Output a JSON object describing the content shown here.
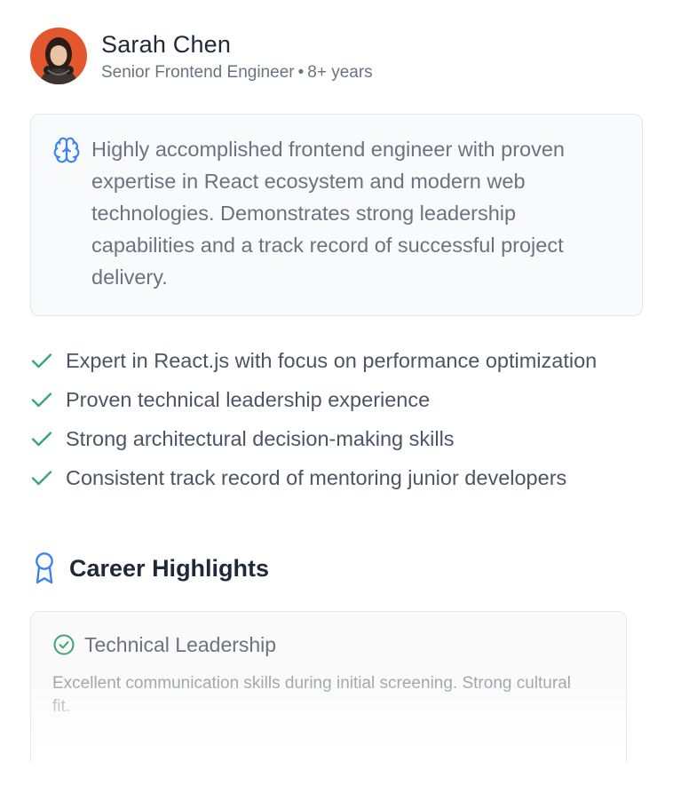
{
  "profile": {
    "name": "Sarah Chen",
    "role": "Senior Frontend Engineer",
    "separator": "•",
    "experience": "8+ years",
    "avatar_icon": "avatar-photo"
  },
  "summary": {
    "icon": "brain-icon",
    "text": "Highly accomplished frontend engineer with proven expertise in React ecosystem and modern web technologies. Demonstrates strong leadership capabilities and a track record of successful project delivery."
  },
  "strengths": [
    "Expert in React.js with focus on performance optimization",
    "Proven technical leadership experience",
    "Strong architectural decision-making skills",
    "Consistent track record of mentoring junior developers"
  ],
  "highlights": {
    "title": "Career Highlights",
    "icon": "award-icon",
    "items": [
      {
        "title": "Technical Leadership",
        "description": "Excellent communication skills during initial screening. Strong cultural fit."
      }
    ]
  },
  "colors": {
    "check_green": "#3aa873",
    "accent_blue": "#3b82f6",
    "avatar_bg": "#e4572e"
  }
}
